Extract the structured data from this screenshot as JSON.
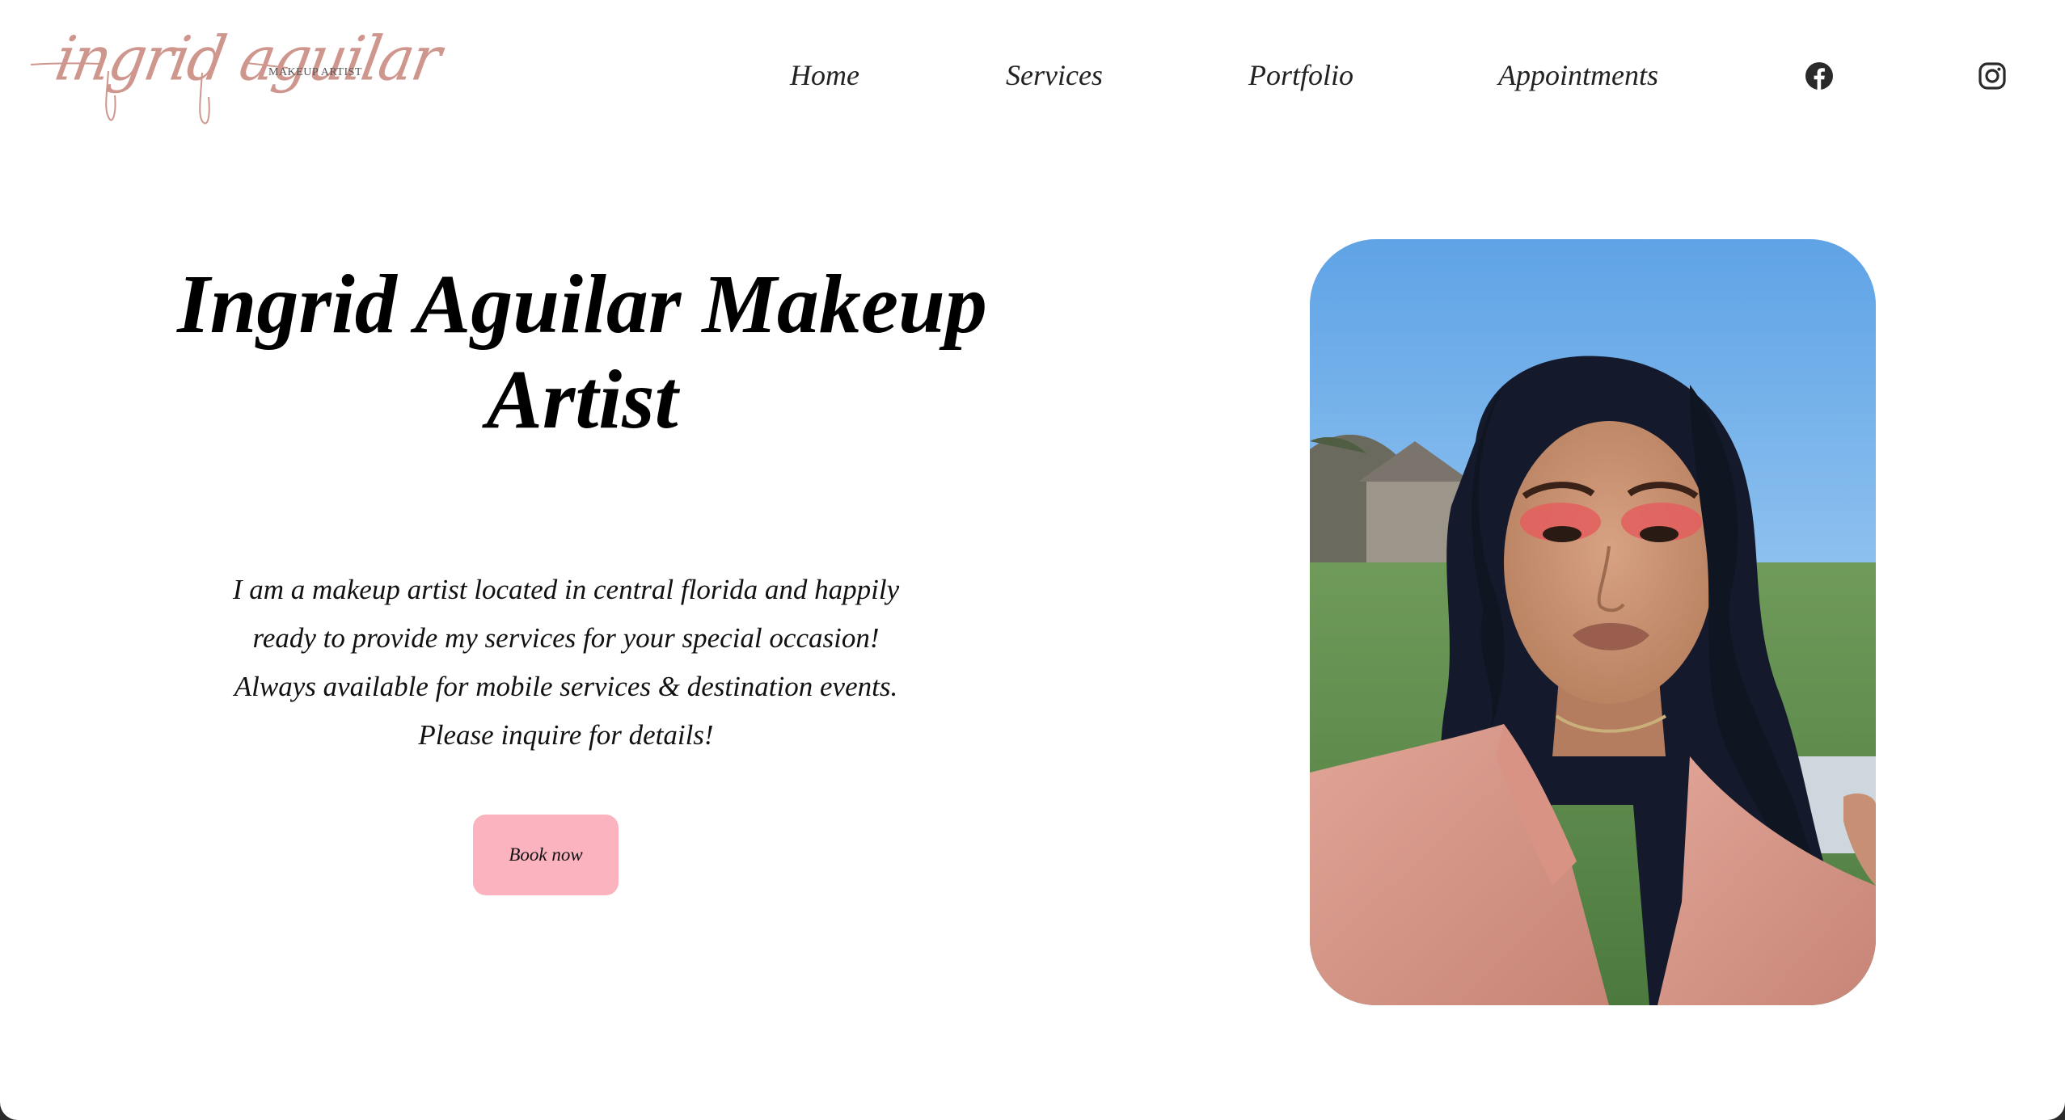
{
  "brand": {
    "logo_script": "ingrid aguilar",
    "logo_sub": "MAKEUP ARTIST",
    "accent_color": "#cf968d"
  },
  "nav": {
    "items": [
      {
        "label": "Home"
      },
      {
        "label": "Services"
      },
      {
        "label": "Portfolio"
      },
      {
        "label": "Appointments"
      }
    ],
    "social": [
      "facebook-icon",
      "instagram-icon"
    ]
  },
  "hero": {
    "title": "Ingrid Aguilar Makeup Artist",
    "lines": [
      "I am a makeup artist located in central florida and happily",
      "ready to provide my services for your special occasion!",
      "Always available for mobile services & destination events.",
      "Please inquire for details!"
    ],
    "cta_label": "Book now",
    "cta_color": "#fbb3bf"
  }
}
